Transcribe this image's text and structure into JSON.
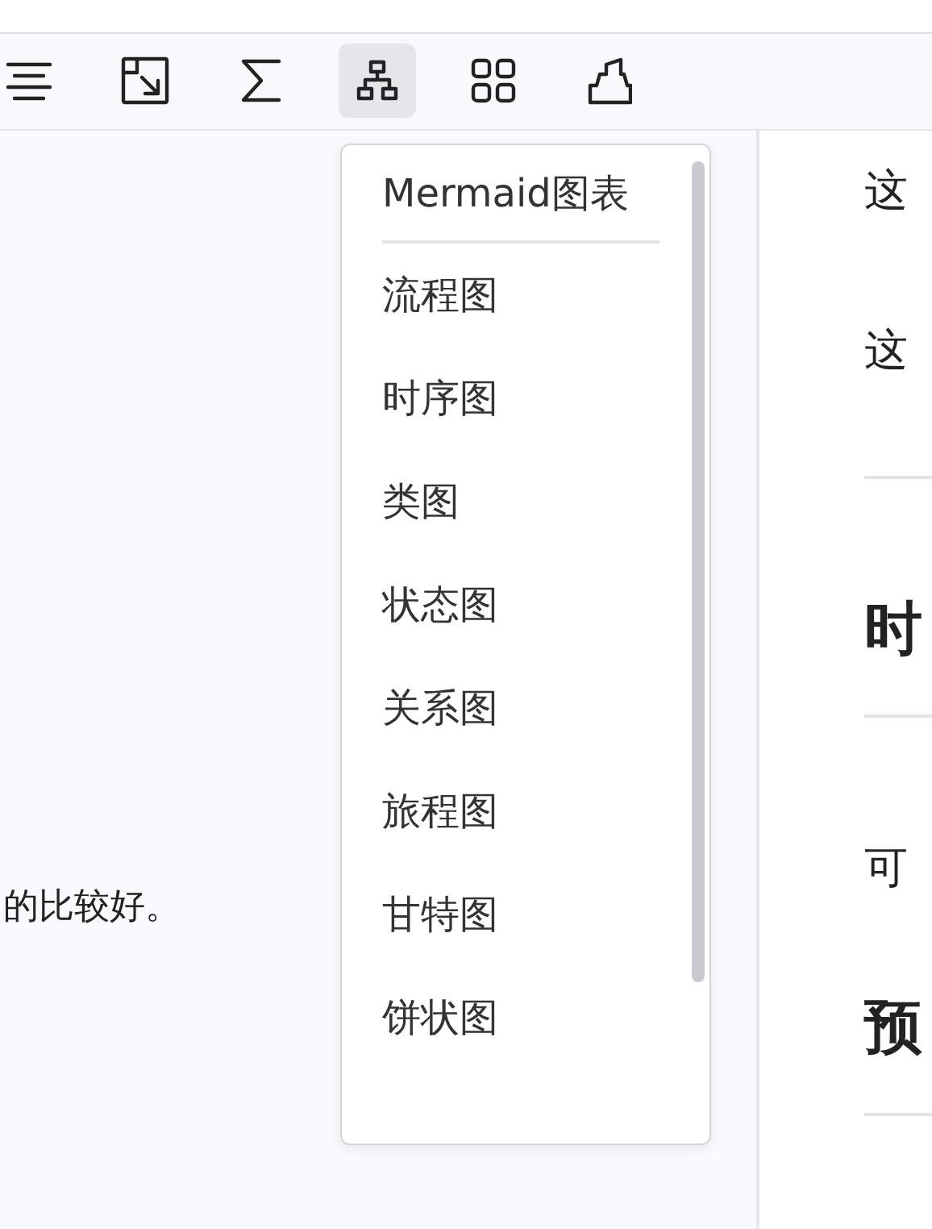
{
  "toolbar": [
    {
      "kind": "align",
      "selected": false
    },
    {
      "kind": "resize",
      "selected": false
    },
    {
      "kind": "sigma",
      "selected": false
    },
    {
      "kind": "diagram",
      "selected": true
    },
    {
      "kind": "grid",
      "selected": false
    },
    {
      "kind": "marker",
      "selected": false
    }
  ],
  "editor": {
    "text": "的比较好。"
  },
  "menu": {
    "title": "Mermaid图表",
    "items": [
      "流程图",
      "时序图",
      "类图",
      "状态图",
      "关系图",
      "旅程图",
      "甘特图",
      "饼状图"
    ]
  },
  "preview": [
    {
      "kind": "text",
      "text": "这"
    },
    {
      "kind": "text",
      "text": "这"
    },
    {
      "kind": "rule"
    },
    {
      "kind": "heading",
      "text": "时"
    },
    {
      "kind": "rule"
    },
    {
      "kind": "text",
      "text": "可"
    },
    {
      "kind": "heading",
      "text": "预"
    },
    {
      "kind": "rule"
    }
  ]
}
